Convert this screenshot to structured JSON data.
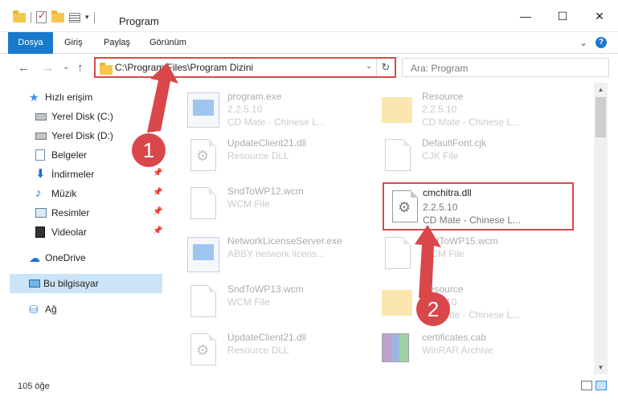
{
  "window": {
    "title": "Program",
    "minimize": "—",
    "maximize": "☐",
    "close": "✕"
  },
  "ribbon": {
    "tabs": [
      "Dosya",
      "Giriş",
      "Paylaş",
      "Görünüm"
    ],
    "expand": "⌄",
    "help": "?"
  },
  "nav": {
    "back": "←",
    "forward": "→",
    "recent": "⌄",
    "up": "↑",
    "address": "C:\\Program Files\\Program Dizini",
    "address_dropdown": "⌄",
    "refresh": "↻",
    "search_placeholder": "Ara: Program"
  },
  "sidebar": {
    "items": [
      {
        "label": "Hızlı erişim",
        "icon": "star-icon"
      },
      {
        "label": "Yerel Disk (C:)",
        "icon": "disk-icon"
      },
      {
        "label": "Yerel Disk (D:)",
        "icon": "disk-icon"
      },
      {
        "label": "Belgeler",
        "icon": "document-icon"
      },
      {
        "label": "İndirmeler",
        "icon": "download-icon"
      },
      {
        "label": "Müzik",
        "icon": "music-icon"
      },
      {
        "label": "Resimler",
        "icon": "pictures-icon"
      },
      {
        "label": "Videolar",
        "icon": "video-icon"
      },
      {
        "label": "OneDrive",
        "icon": "cloud-icon"
      },
      {
        "label": "Bu bilgisayar",
        "icon": "computer-icon"
      },
      {
        "label": "Ağ",
        "icon": "network-icon"
      }
    ]
  },
  "files": [
    {
      "name": "program.exe",
      "line2": "2.2.5.10",
      "line3": "CD Mate - Chinese L...",
      "icon": "exe-icon"
    },
    {
      "name": "Resource",
      "line2": "2.2.5.10",
      "line3": "CD Mate - Chinese L...",
      "icon": "folder-icon"
    },
    {
      "name": "UpdateClient21.dll",
      "line2": "Resource DLL",
      "line3": "",
      "icon": "dll-icon"
    },
    {
      "name": "DefaultFont.cjk",
      "line2": "CJK File",
      "line3": "",
      "icon": "file-icon"
    },
    {
      "name": "SndToWP12.wcm",
      "line2": "WCM File",
      "line3": "",
      "icon": "file-icon"
    },
    {
      "name": "cmchitra.dll",
      "line2": "2.2.5.10",
      "line3": "CD Mate - Chinese L...",
      "icon": "dll-icon"
    },
    {
      "name": "NetworkLicenseServer.exe",
      "line2": "ABBY network licens...",
      "line3": "",
      "icon": "exe-icon"
    },
    {
      "name": "SndToWP15.wcm",
      "line2": "WCM File",
      "line3": "",
      "icon": "file-icon"
    },
    {
      "name": "SndToWP13.wcm",
      "line2": "WCM File",
      "line3": "",
      "icon": "file-icon"
    },
    {
      "name": "Resource",
      "line2": "2.2.5.10",
      "line3": "CD Mate - Chinese L...",
      "icon": "folder-icon"
    },
    {
      "name": "UpdateClient21.dll",
      "line2": "Resource DLL",
      "line3": "",
      "icon": "dll-icon"
    },
    {
      "name": "certificates.cab",
      "line2": "WinRAR Archive",
      "line3": "",
      "icon": "archive-icon"
    }
  ],
  "status": {
    "count": "105 öğe"
  },
  "callouts": [
    "1",
    "2"
  ],
  "colors": {
    "accent": "#1979ca",
    "highlight": "#d9474a",
    "selection": "#cce4f7"
  }
}
